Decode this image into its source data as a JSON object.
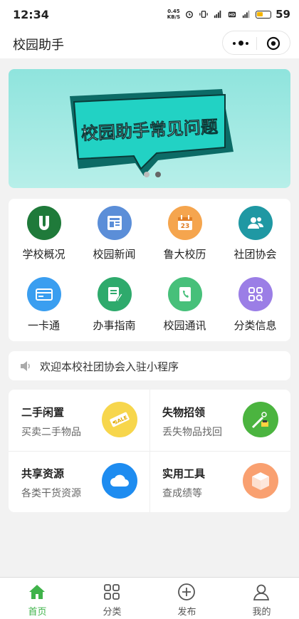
{
  "status_bar": {
    "time": "12:34",
    "net_speed_value": "0.45",
    "net_speed_unit": "KB/S",
    "battery": "59"
  },
  "nav": {
    "title": "校园助手"
  },
  "banner": {
    "headline": "校园助手常见问题",
    "slides": 2,
    "active_slide": 2
  },
  "grid": {
    "items": [
      {
        "label": "学校概况",
        "icon": "school-u-logo-icon",
        "color": "#1f7a3a"
      },
      {
        "label": "校园新闻",
        "icon": "newspaper-icon",
        "color": "#5b8ed8"
      },
      {
        "label": "鲁大校历",
        "icon": "calendar-icon",
        "color": "#f5a54e"
      },
      {
        "label": "社团协会",
        "icon": "group-icon",
        "color": "#1f98a3"
      },
      {
        "label": "一卡通",
        "icon": "card-icon",
        "color": "#3a9ef0"
      },
      {
        "label": "办事指南",
        "icon": "guide-edit-icon",
        "color": "#2eaa6c"
      },
      {
        "label": "校园通讯",
        "icon": "phone-book-icon",
        "color": "#47c07a"
      },
      {
        "label": "分类信息",
        "icon": "category-icon",
        "color": "#9b7ee6"
      }
    ]
  },
  "notice": {
    "text": "欢迎本校社团协会入驻小程序",
    "icon": "speaker-icon"
  },
  "cards": [
    {
      "title": "二手闲置",
      "subtitle": "买卖二手物品",
      "icon": "sale-tag-icon",
      "color": "#f7d64c",
      "icon_text": "SALE"
    },
    {
      "title": "失物招领",
      "subtitle": "丢失物品找回",
      "icon": "lost-found-icon",
      "color": "#4bb43f"
    },
    {
      "title": "共享资源",
      "subtitle": "各类干货资源",
      "icon": "cloud-icon",
      "color": "#1e8cf0"
    },
    {
      "title": "实用工具",
      "subtitle": "查成绩等",
      "icon": "box-icon",
      "color": "#f9a070"
    }
  ],
  "tabbar": {
    "tabs": [
      {
        "label": "首页",
        "icon": "home-icon"
      },
      {
        "label": "分类",
        "icon": "grid-category-icon"
      },
      {
        "label": "发布",
        "icon": "plus-circle-icon"
      },
      {
        "label": "我的",
        "icon": "user-icon"
      }
    ],
    "active_color": "#3fb34a"
  }
}
